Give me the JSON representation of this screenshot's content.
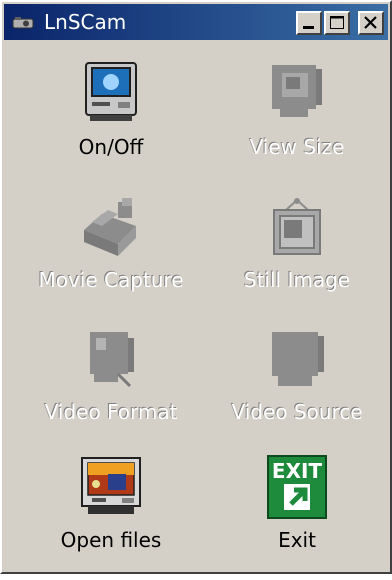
{
  "window": {
    "title": "LnSCam",
    "controls": {
      "minimize_icon": "minimize-icon",
      "maximize_icon": "maximize-icon",
      "close_icon": "close-icon"
    }
  },
  "items": [
    {
      "label": "On/Off",
      "icon": "monitor-icon",
      "enabled": true
    },
    {
      "label": "View Size",
      "icon": "view-size-icon",
      "enabled": false
    },
    {
      "label": "Movie Capture",
      "icon": "movie-capture-icon",
      "enabled": false
    },
    {
      "label": "Still Image",
      "icon": "still-image-icon",
      "enabled": false
    },
    {
      "label": "Video Format",
      "icon": "video-format-icon",
      "enabled": false
    },
    {
      "label": "Video Source",
      "icon": "video-source-icon",
      "enabled": false
    },
    {
      "label": "Open files",
      "icon": "open-files-icon",
      "enabled": true
    },
    {
      "label": "Exit",
      "icon": "exit-icon",
      "enabled": true,
      "icon_text": "EXIT"
    }
  ],
  "colors": {
    "titlebar_start": "#0a246a",
    "titlebar_end": "#3a6ea5",
    "window_face": "#d4d0c8",
    "disabled_icon": "#8c8c8c",
    "exit_green": "#1e8a3c"
  }
}
